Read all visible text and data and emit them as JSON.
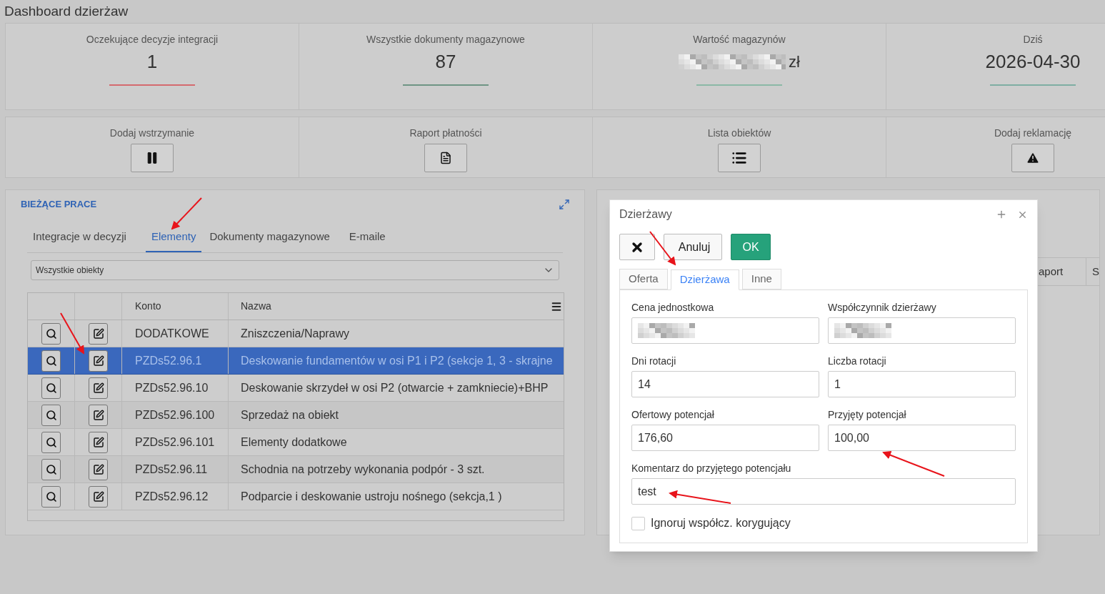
{
  "page_title": "Dashboard dzierżaw",
  "stats": [
    {
      "label": "Oczekujące decyzje integracji",
      "kind": "plain",
      "value": "1",
      "color": "#d46a6f"
    },
    {
      "label": "Wszystkie dokumenty magazynowe",
      "kind": "plain",
      "value": "87",
      "color": "#6f9585"
    },
    {
      "label": "Wartość magazynów",
      "kind": "masked",
      "value": "zł",
      "color": "#8bb8a6"
    },
    {
      "label": "Dziś",
      "kind": "plain",
      "value": "2026-04-30",
      "color": "#7eaea3"
    }
  ],
  "actions": [
    {
      "label": "Dodaj wstrzymanie",
      "kind": "pause"
    },
    {
      "label": "Raport płatności",
      "kind": "report"
    },
    {
      "label": "Lista obiektów",
      "kind": "list"
    },
    {
      "label": "Dodaj reklamację",
      "kind": "complaint"
    }
  ],
  "panel": {
    "title": "BIEŻĄCE PRACE",
    "tabs": [
      {
        "label": "Integracje w decyzji",
        "selected": false
      },
      {
        "label": "Elementy",
        "selected": true
      },
      {
        "label": "Dokumenty magazynowe",
        "selected": false
      },
      {
        "label": "E-maile",
        "selected": false
      }
    ],
    "filter": {
      "value": "Wszystkie obiekty"
    },
    "table": {
      "columns": [
        "Konto",
        "Nazwa"
      ],
      "rows": [
        {
          "konto": "DODATKOWE",
          "nazwa": "Zniszczenia/Naprawy",
          "selected": false
        },
        {
          "konto": "PZDs52.96.1",
          "nazwa": "Deskowanie fundamentów w osi P1 i P2 (sekcje 1, 3 - skrajne",
          "selected": true
        },
        {
          "konto": "PZDs52.96.10",
          "nazwa": "Deskowanie skrzydeł w osi P2 (otwarcie + zamkniecie)+BHP",
          "selected": false
        },
        {
          "konto": "PZDs52.96.100",
          "nazwa": "Sprzedaż na obiekt",
          "selected": false
        },
        {
          "konto": "PZDs52.96.101",
          "nazwa": "Elementy dodatkowe",
          "selected": false
        },
        {
          "konto": "PZDs52.96.11",
          "nazwa": "Schodnia na potrzeby wykonania podpór - 3 szt.",
          "selected": false
        },
        {
          "konto": "PZDs52.96.12",
          "nazwa": "Podparcie i deskowanie ustroju nośnego (sekcja,1 )",
          "selected": false
        }
      ]
    }
  },
  "back_panel": {
    "header_cells": [
      "aport",
      "S"
    ]
  },
  "dialog": {
    "title": "Dzierżawy",
    "cancel": "Anuluj",
    "ok": "OK",
    "tabs": [
      {
        "label": "Oferta",
        "selected": false
      },
      {
        "label": "Dzierżawa",
        "selected": true
      },
      {
        "label": "Inne",
        "selected": false
      }
    ],
    "fields": [
      {
        "label": "Cena jednostkowa",
        "kind": "masked"
      },
      {
        "label": "Współczynnik dzierżawy",
        "kind": "masked"
      },
      {
        "label": "Dni rotacji",
        "kind": "plain",
        "value": "14"
      },
      {
        "label": "Liczba rotacji",
        "kind": "plain",
        "value": "1"
      },
      {
        "label": "Ofertowy potencjał",
        "kind": "plain",
        "value": "176,60"
      },
      {
        "label": "Przyjęty potencjał",
        "kind": "plain",
        "value": "100,00"
      },
      {
        "label": "Komentarz do przyjętego potencjału",
        "kind": "wide",
        "value": "test"
      }
    ],
    "checkbox": {
      "label": "Ignoruj współcz. korygujący",
      "checked": false
    }
  }
}
